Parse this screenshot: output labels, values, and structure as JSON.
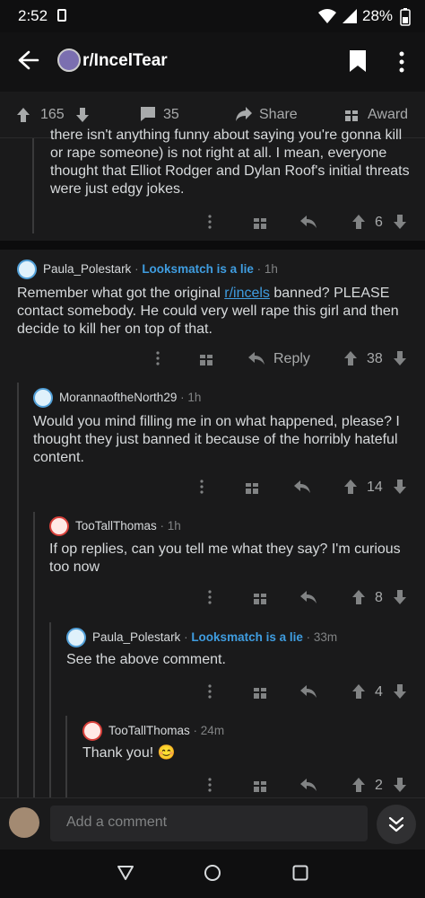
{
  "status": {
    "time": "2:52",
    "battery": "28%"
  },
  "header": {
    "subreddit": "r/IncelTear"
  },
  "post_actions": {
    "upvotes": "165",
    "comments": "35",
    "share": "Share",
    "award": "Award"
  },
  "comment0": {
    "text": "there isn't anything funny about saying you're gonna kill or rape someone) is not right at all. I mean, everyone thought that Elliot Rodger and Dylan Roof's initial threats were just edgy jokes.",
    "votes": "6"
  },
  "comment1": {
    "user": "Paula_Polestark",
    "flair": "Looksmatch is a lie",
    "age": "1h",
    "text_before": "Remember what got the original ",
    "link": "r/incels",
    "text_after": " banned? PLEASE contact somebody. He could very well rape this girl and then decide to kill her on top of that.",
    "reply_label": "Reply",
    "votes": "38"
  },
  "comment2": {
    "user": "MorannaoftheNorth29",
    "age": "1h",
    "text": "Would you mind filling me in on what happened, please? I thought they just banned it because of the horribly hateful content.",
    "votes": "14"
  },
  "comment3": {
    "user": "TooTallThomas",
    "age": "1h",
    "text": "If op replies, can you tell me what they say? I'm curious too now",
    "votes": "8"
  },
  "comment4": {
    "user": "Paula_Polestark",
    "flair": "Looksmatch is a lie",
    "age": "33m",
    "text": "See the above comment.",
    "votes": "4"
  },
  "comment5": {
    "user": "TooTallThomas",
    "age": "24m",
    "text": "Thank you! 😊",
    "votes": "2"
  },
  "composer": {
    "placeholder": "Add a comment"
  },
  "colors": {
    "background": "#1a1a1b",
    "accent": "#3f9de0",
    "text": "#d7dadc",
    "muted": "#818384"
  }
}
